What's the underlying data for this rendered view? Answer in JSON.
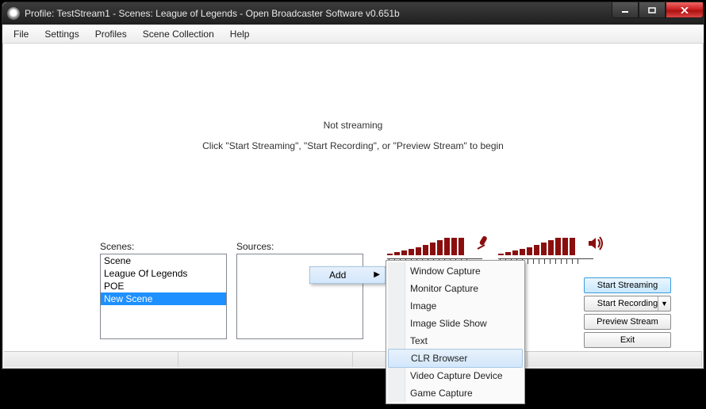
{
  "title": "Profile: TestStream1 - Scenes: League of Legends - Open Broadcaster Software v0.651b",
  "menu": {
    "file": "File",
    "settings": "Settings",
    "profiles": "Profiles",
    "scene_collection": "Scene Collection",
    "help": "Help"
  },
  "status": {
    "line1": "Not streaming",
    "line2": "Click \"Start Streaming\", \"Start Recording\", or \"Preview Stream\" to begin"
  },
  "panels": {
    "scenes_label": "Scenes:",
    "sources_label": "Sources:",
    "scenes": [
      "Scene",
      "League Of Legends",
      "POE",
      "New Scene"
    ],
    "selected_scene": 3
  },
  "buttons": {
    "start_streaming": "Start Streaming",
    "start_recording": "Start Recording",
    "preview_stream": "Preview Stream",
    "exit": "Exit"
  },
  "context": {
    "add": "Add",
    "sub": [
      "Window Capture",
      "Monitor Capture",
      "Image",
      "Image Slide Show",
      "Text",
      "CLR Browser",
      "Video Capture Device",
      "Game Capture"
    ],
    "hover_sub": 5
  }
}
